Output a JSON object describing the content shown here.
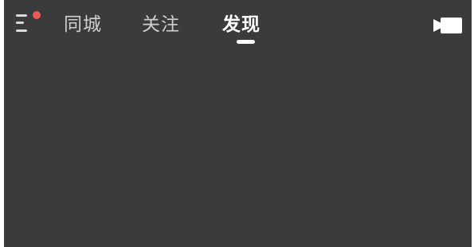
{
  "header": {
    "menu": {
      "icon": "menu-icon",
      "has_notification_dot": true,
      "dot_color": "#ee5a56"
    },
    "tabs": [
      {
        "label": "同城",
        "active": false
      },
      {
        "label": "关注",
        "active": false
      },
      {
        "label": "发现",
        "active": true
      }
    ],
    "camera": {
      "icon": "video-camera-icon"
    }
  },
  "colors": {
    "background": "#3b3b3b",
    "tab_inactive": "#cfcfcf",
    "tab_active": "#ffffff",
    "indicator": "#ffffff"
  }
}
